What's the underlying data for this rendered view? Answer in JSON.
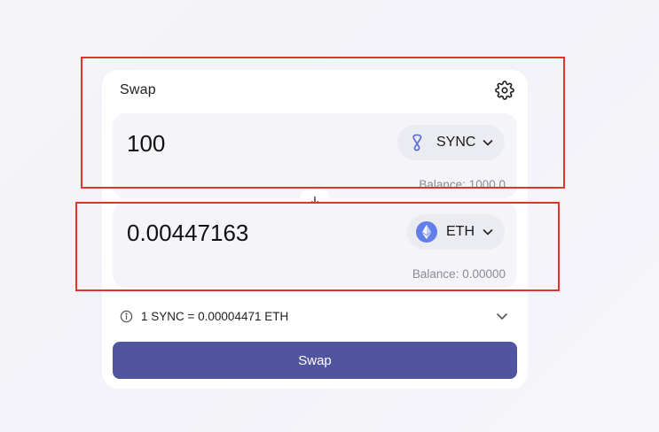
{
  "card": {
    "title": "Swap"
  },
  "from": {
    "amount": "100",
    "token": "SYNC",
    "balance": "Balance: 1000.0"
  },
  "to": {
    "amount": "0.00447163",
    "token": "ETH",
    "balance": "Balance: 0.00000"
  },
  "rate": {
    "text": "1 SYNC = 0.00004471 ETH"
  },
  "swap_button": {
    "label": "Swap"
  },
  "colors": {
    "primary_button": "#5155a0",
    "annotation_box": "#e0352b",
    "eth_icon": "#627eea",
    "sync_icon": "#5468d4"
  },
  "icons": [
    "gear-icon",
    "sync-token-icon",
    "eth-token-icon",
    "chevron-down-icon",
    "arrow-down-icon",
    "info-icon"
  ]
}
